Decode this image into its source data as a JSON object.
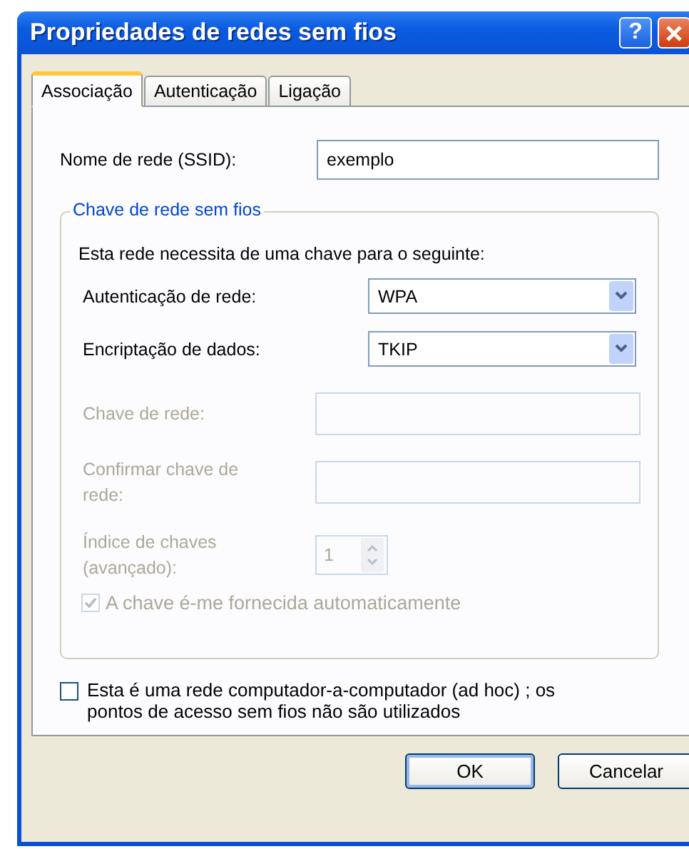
{
  "window": {
    "title": "Propriedades de redes sem fios",
    "help_label": "?"
  },
  "tabs": [
    {
      "label": "Associação",
      "selected": true
    },
    {
      "label": "Autenticação",
      "selected": false
    },
    {
      "label": "Ligação",
      "selected": false
    }
  ],
  "ssid": {
    "label": "Nome de rede (SSID):",
    "value": "exemplo"
  },
  "key_group": {
    "legend": "Chave de rede sem fios",
    "intro": "Esta rede necessita de uma chave para o seguinte:",
    "rows": [
      {
        "kind": "select",
        "label": "Autenticação de rede:",
        "value": "WPA",
        "disabled": false
      },
      {
        "kind": "select",
        "label": "Encriptação de dados:",
        "value": "TKIP",
        "disabled": false
      },
      {
        "kind": "input",
        "label": "Chave de rede:",
        "disabled": true
      },
      {
        "kind": "input",
        "label": "Confirmar chave de rede:",
        "disabled": true
      },
      {
        "kind": "spinner",
        "label": "Índice de chaves (avançado):",
        "value": "1",
        "disabled": true
      }
    ],
    "auto_key": {
      "label": "A chave é-me fornecida automaticamente",
      "checked": true,
      "disabled": true
    }
  },
  "adhoc": {
    "label": "Esta é uma rede computador-a-computador (ad hoc) ; os pontos de acesso sem fios não são utilizados",
    "checked": false,
    "disabled": false
  },
  "buttons": [
    {
      "label": "OK",
      "default": true
    },
    {
      "label": "Cancelar",
      "default": false
    }
  ]
}
